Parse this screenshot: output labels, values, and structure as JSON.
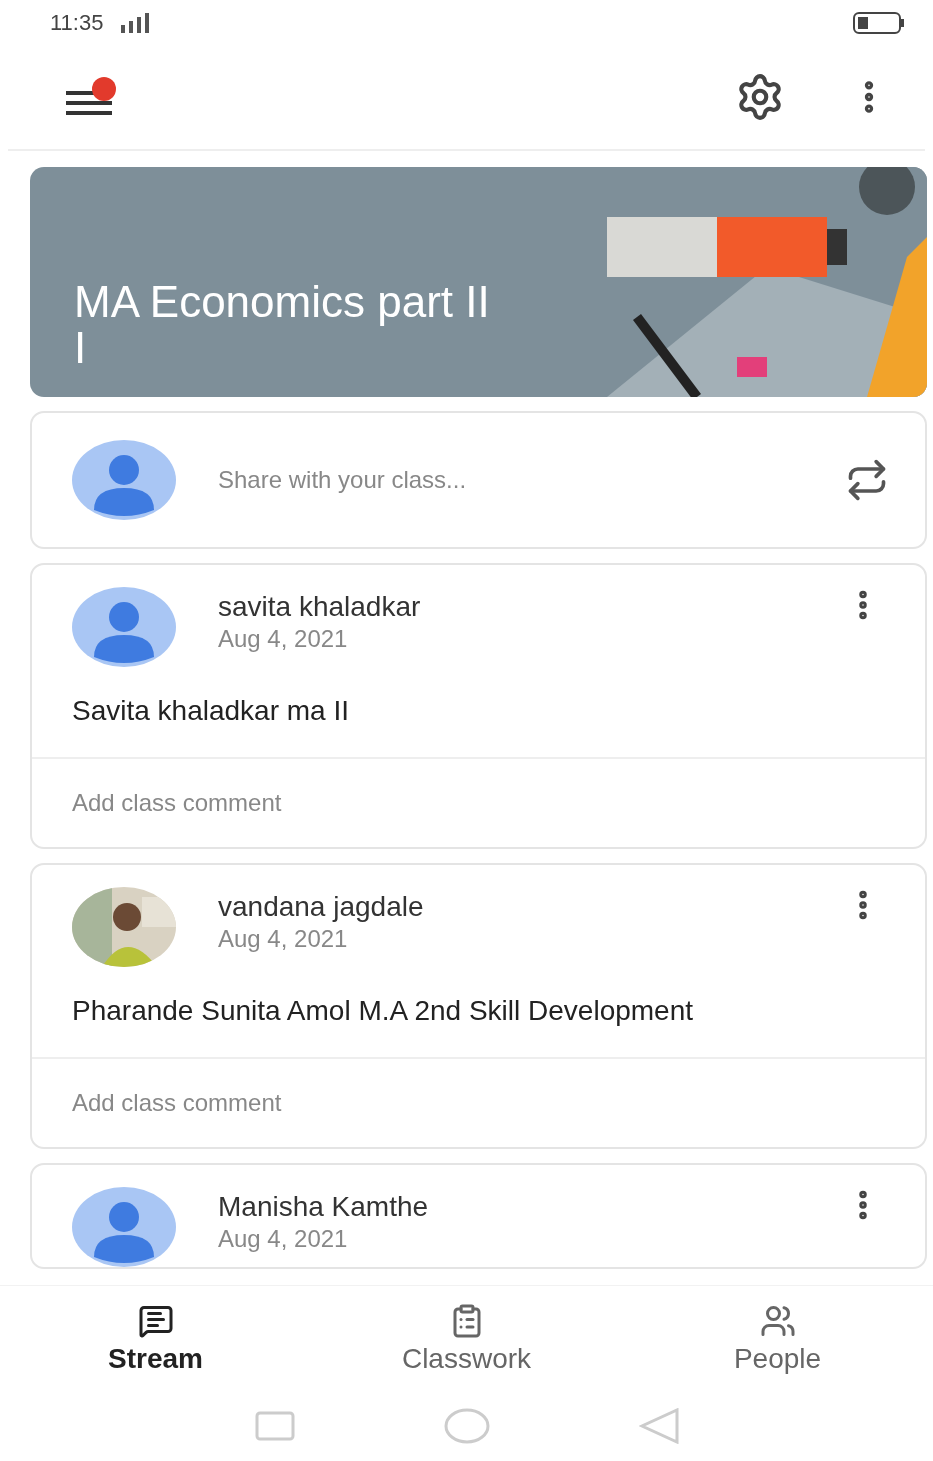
{
  "status_bar": {
    "time": "11:35"
  },
  "class": {
    "title_lines": [
      "MA Economics part II",
      "I"
    ]
  },
  "share": {
    "placeholder": "Share with your class..."
  },
  "posts": [
    {
      "author": "savita khaladkar",
      "date": "Aug 4, 2021",
      "kind": "default",
      "text": "Savita khaladkar ma II",
      "comment_placeholder": "Add class comment"
    },
    {
      "author": "vandana jagdale",
      "date": "Aug 4, 2021",
      "kind": "picture",
      "text": "Pharande Sunita Amol M.A 2nd  Skill Development",
      "comment_placeholder": "Add class comment"
    },
    {
      "author": "Manisha Kamthe",
      "date": "Aug 4, 2021",
      "kind": "default"
    }
  ],
  "tabs": [
    {
      "label": "Stream",
      "kind": "stream",
      "selected": true
    },
    {
      "label": "Classwork",
      "kind": "classwork",
      "selected": false
    },
    {
      "label": "People",
      "kind": "people",
      "selected": false
    }
  ]
}
